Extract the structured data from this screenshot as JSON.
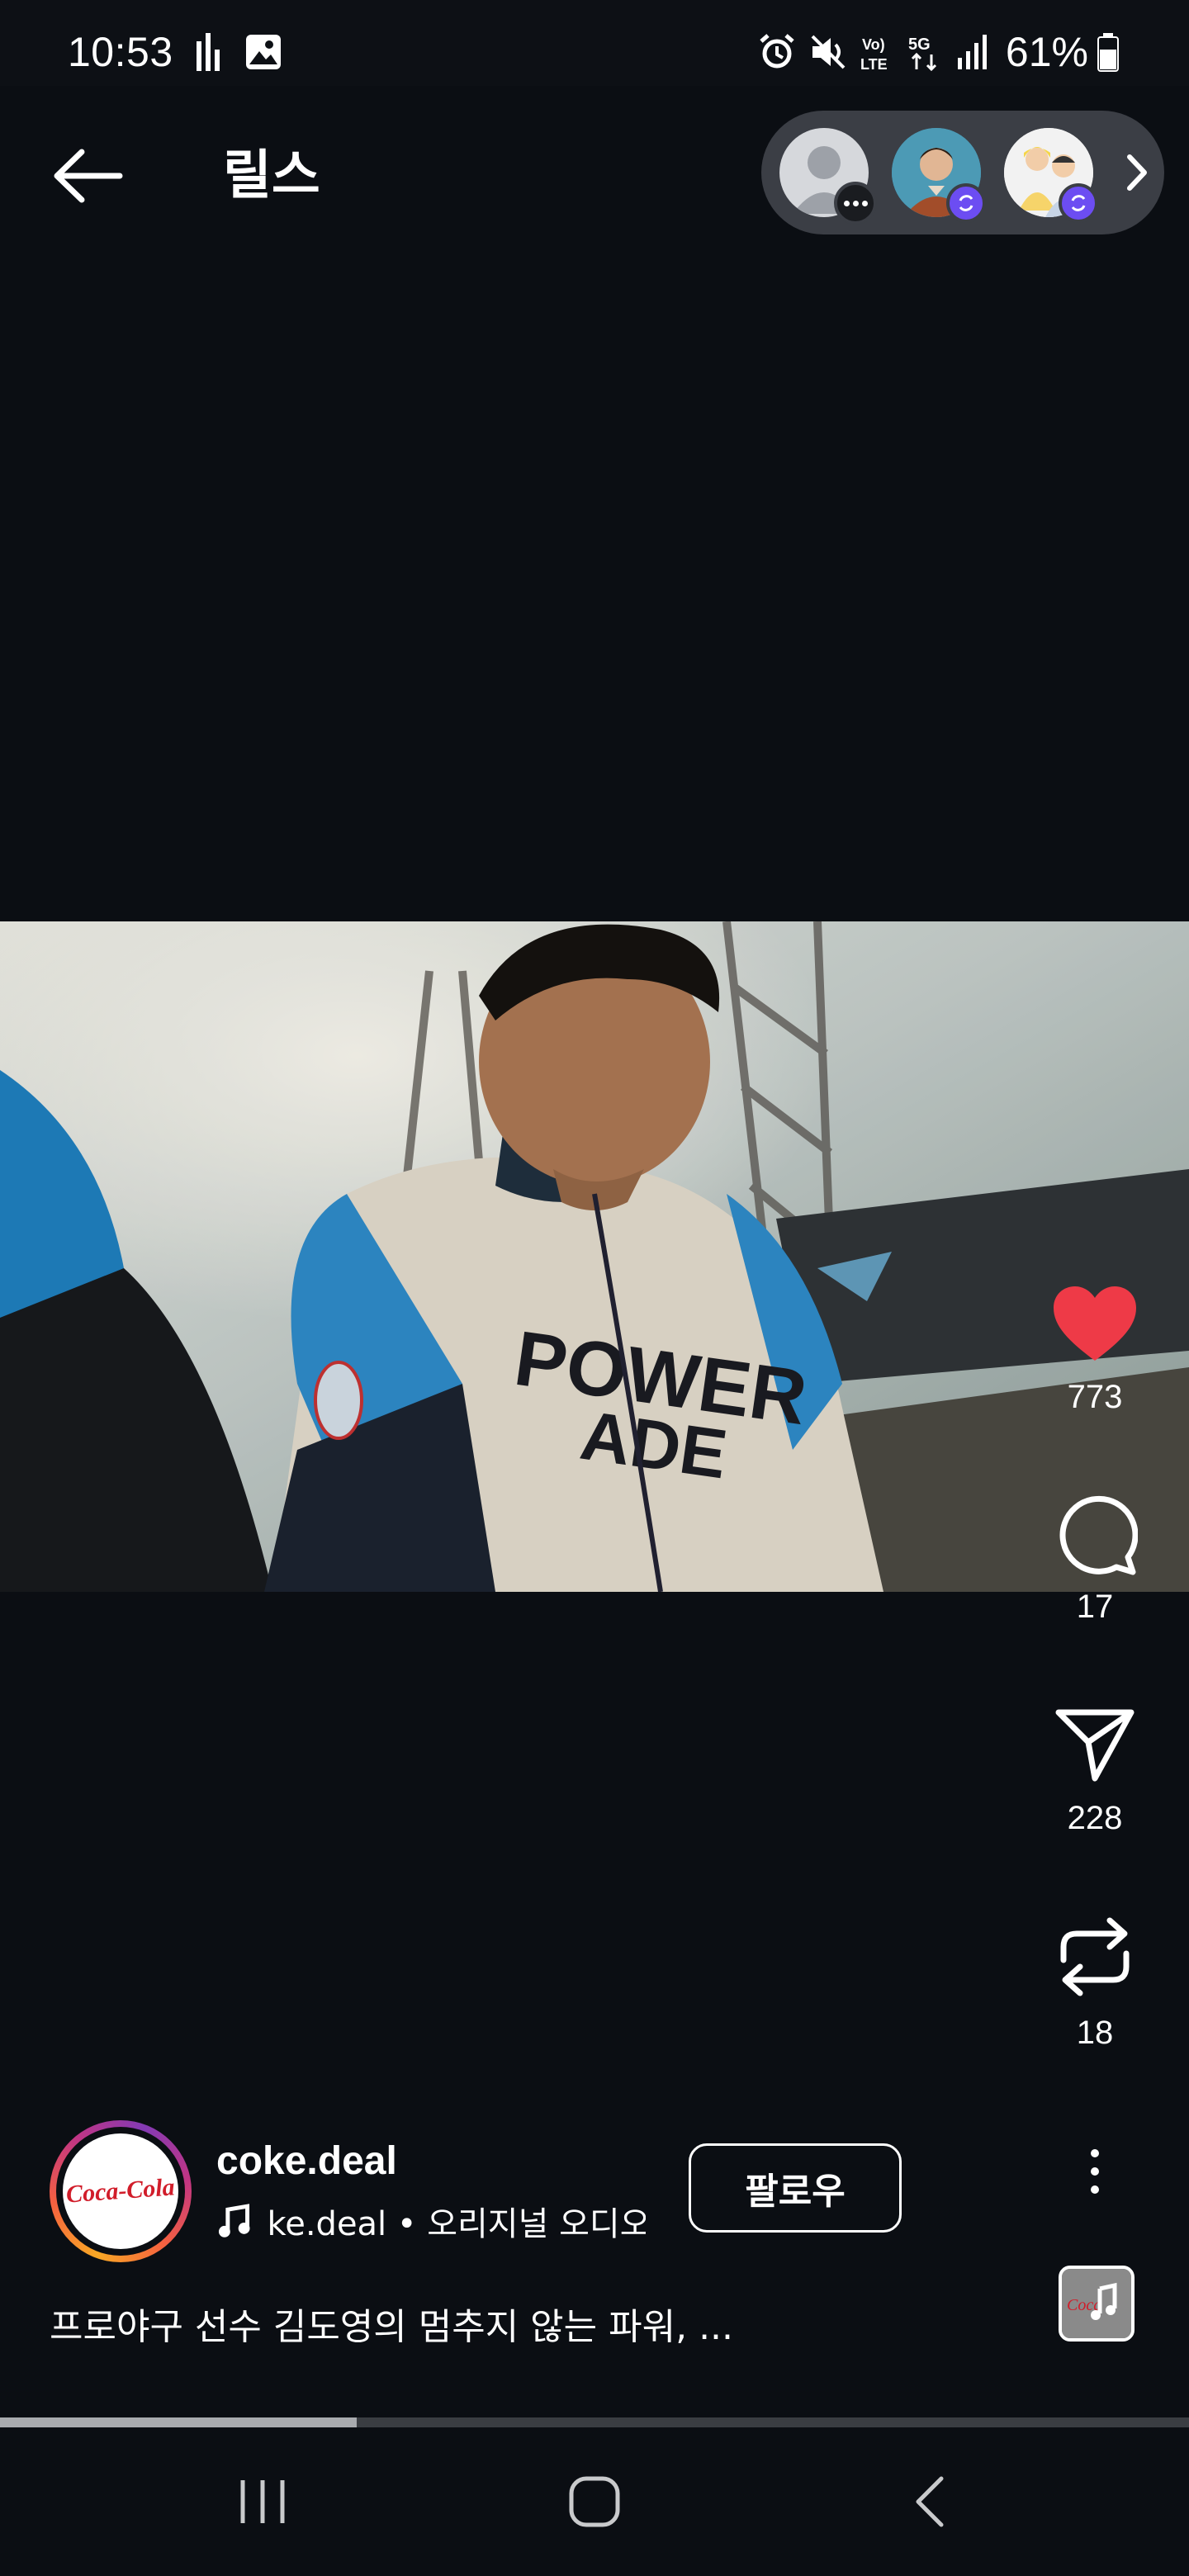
{
  "status_bar": {
    "time": "10:53",
    "battery": "61%",
    "icons": [
      "signal-bars-icon",
      "gallery-icon",
      "alarm-icon",
      "mute-icon",
      "volte-icon",
      "5g-icon",
      "cell-signal-icon",
      "battery-icon"
    ]
  },
  "header": {
    "title": "릴스",
    "back_icon": "arrow-left-icon"
  },
  "viewers": {
    "chevron_icon": "chevron-right-icon"
  },
  "reel": {
    "likes": "773",
    "comments": "17",
    "shares": "228",
    "reposts": "18",
    "progress_fraction": 0.3
  },
  "author": {
    "username": "coke.deal",
    "logo_text": "Coca-Cola",
    "audio": "ke.deal • 오리지널 오디오",
    "follow_label": "팔로우",
    "caption": "프로야구 선수 김도영의 멈추지 않는 파워, ..."
  },
  "colors": {
    "background": "#0b0e13",
    "like": "#ee3a47",
    "badge": "#6c4df2",
    "coke_red": "#d11d2a"
  }
}
